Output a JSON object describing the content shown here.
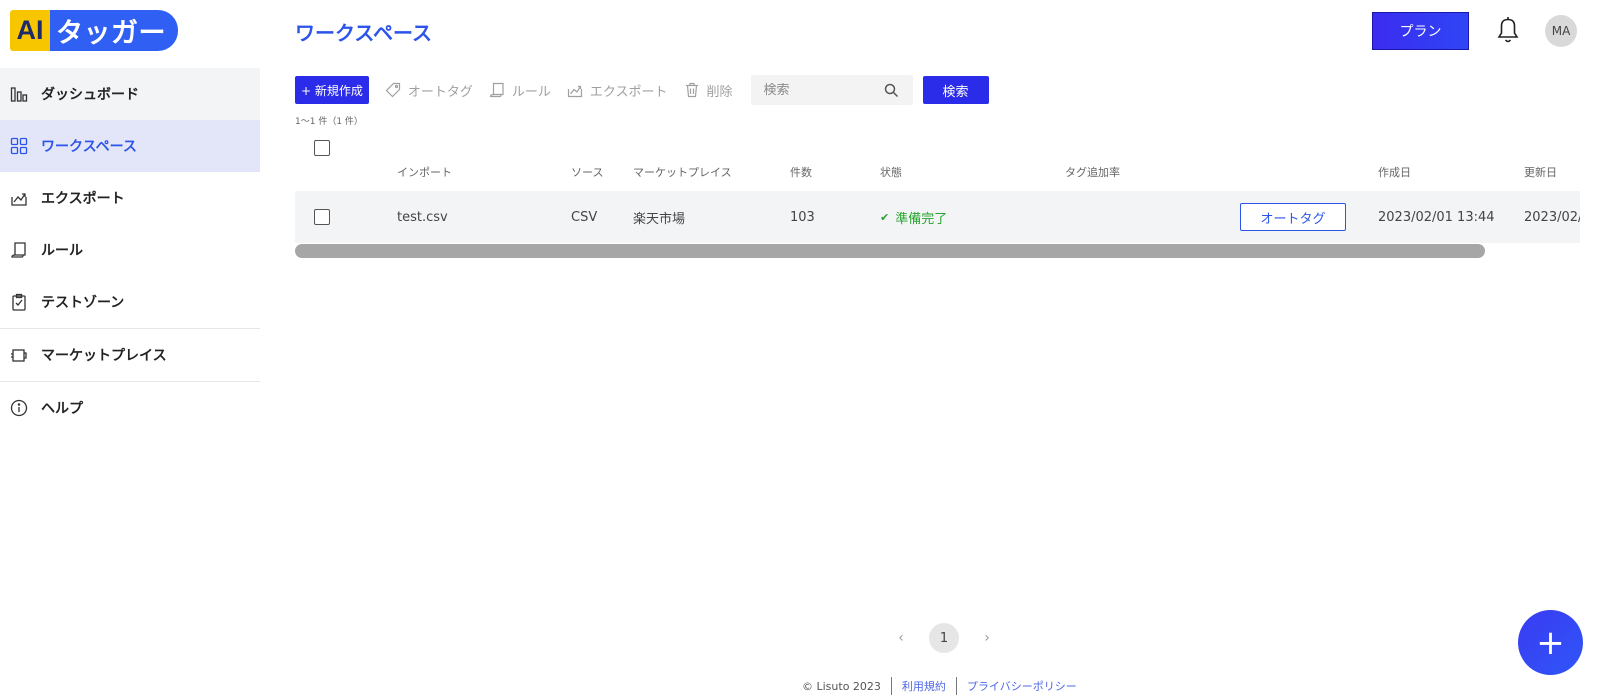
{
  "app": {
    "logo_ai": "AI",
    "logo_name": "タッガー"
  },
  "sidebar": {
    "items": [
      {
        "label": "ダッシュボード",
        "icon": "chart-icon"
      },
      {
        "label": "ワークスペース",
        "icon": "grid-icon"
      },
      {
        "label": "エクスポート",
        "icon": "export-icon"
      },
      {
        "label": "ルール",
        "icon": "scroll-icon"
      },
      {
        "label": "テストゾーン",
        "icon": "clipboard-check-icon"
      },
      {
        "label": "マーケットプレイス",
        "icon": "plugin-icon"
      },
      {
        "label": "ヘルプ",
        "icon": "info-icon"
      }
    ]
  },
  "header": {
    "title": "ワークスペース",
    "plan_label": "プラン",
    "avatar_initials": "MA"
  },
  "toolbar": {
    "new_label": "+ 新規作成",
    "autotag_label": "オートタグ",
    "rule_label": "ルール",
    "export_label": "エクスポート",
    "delete_label": "削除",
    "search_placeholder": "検索",
    "search_button": "検索"
  },
  "count_text": "1～1 件（1 件）",
  "table": {
    "columns": [
      "インポート",
      "ソース",
      "マーケットプレイス",
      "件数",
      "状態",
      "タグ追加率",
      "作成日",
      "更新日"
    ],
    "rows": [
      {
        "import": "test.csv",
        "source": "CSV",
        "marketplace": "楽天市場",
        "count": "103",
        "status": "準備完了",
        "action": "オートタグ",
        "created": "2023/02/01 13:44",
        "updated": "2023/02/"
      }
    ]
  },
  "pagination": {
    "current": "1"
  },
  "footer": {
    "copyright": "© Lisuto 2023",
    "terms": "利用規約",
    "privacy": "プライバシーポリシー"
  },
  "fab_label": "+",
  "colors": {
    "accent": "#2d54ea",
    "button": "#2b2cea",
    "status_ok": "#27a42c",
    "logo_yellow": "#f7c600"
  }
}
